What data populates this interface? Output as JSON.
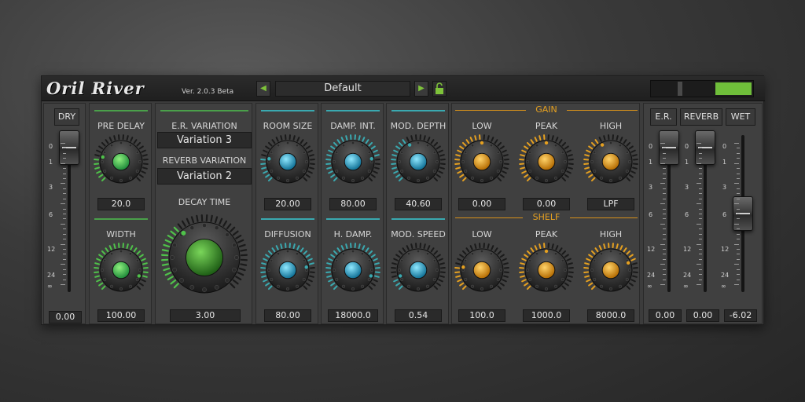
{
  "header": {
    "logo": "Oril River",
    "version": "Ver. 2.0.3 Beta",
    "preset": "Default",
    "prev_icon": "triangle-left",
    "next_icon": "triangle-right",
    "lock_icon": "unlocked-padlock"
  },
  "dry": {
    "button": "DRY",
    "value": "0.00"
  },
  "predelay": {
    "label": "PRE DELAY",
    "value": "20.0"
  },
  "width": {
    "label": "WIDTH",
    "value": "100.00"
  },
  "variation": {
    "er_label": "E.R. VARIATION",
    "er_value": "Variation 3",
    "rev_label": "REVERB VARIATION",
    "rev_value": "Variation 2",
    "decay_label": "DECAY TIME",
    "decay_value": "3.00"
  },
  "room": {
    "label": "ROOM SIZE",
    "value": "20.00"
  },
  "diffusion": {
    "label": "DIFFUSION",
    "value": "80.00"
  },
  "dampint": {
    "label": "DAMP. INT.",
    "value": "80.00"
  },
  "hdamp": {
    "label": "H. DAMP.",
    "value": "18000.0"
  },
  "moddepth": {
    "label": "MOD. DEPTH",
    "value": "40.60"
  },
  "modspeed": {
    "label": "MOD. SPEED",
    "value": "0.54"
  },
  "gain": {
    "title": "GAIN",
    "low_label": "LOW",
    "low_value": "0.00",
    "peak_label": "PEAK",
    "peak_value": "0.00",
    "high_label": "HIGH",
    "high_value": "LPF"
  },
  "shelf": {
    "title": "SHELF",
    "low_label": "LOW",
    "low_value": "100.0",
    "peak_label": "PEAK",
    "peak_value": "1000.0",
    "high_label": "HIGH",
    "high_value": "8000.0"
  },
  "mix": {
    "er_button": "E.R.",
    "reverb_button": "REVERB",
    "wet_button": "WET",
    "er_value": "0.00",
    "reverb_value": "0.00",
    "wet_value": "-6.02"
  },
  "scale_labels": [
    "0",
    "1",
    "3",
    "6",
    "12",
    "24",
    "∞"
  ],
  "colors": {
    "teal": "#3aa9b0",
    "green": "#4fc24a",
    "orange": "#e5a020",
    "meter": "#6fbe3a"
  }
}
